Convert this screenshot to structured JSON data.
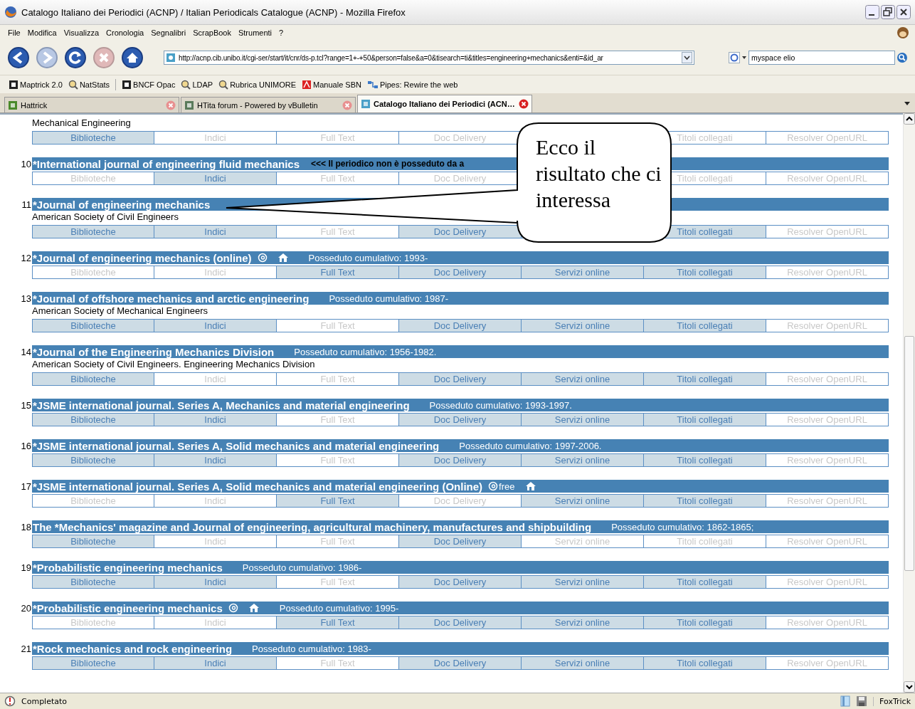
{
  "window": {
    "title": "Catalogo Italiano dei Periodici (ACNP) / Italian Periodicals Catalogue (ACNP) - Mozilla Firefox"
  },
  "menu": [
    "File",
    "Modifica",
    "Visualizza",
    "Cronologia",
    "Segnalibri",
    "ScrapBook",
    "Strumenti",
    "?"
  ],
  "navigation": {
    "buttons": [
      {
        "kind": "back",
        "disabled": false
      },
      {
        "kind": "forward",
        "disabled": true
      },
      {
        "kind": "reload",
        "disabled": false
      },
      {
        "kind": "stop",
        "disabled": true
      },
      {
        "kind": "home",
        "disabled": false
      }
    ],
    "url": "http://acnp.cib.unibo.it/cgi-ser/start/it/cnr/ds-p.tcl?range=1+-+50&person=false&a=0&tisearch=ti&titles=engineering+mechanics&enti=&id_ar",
    "search_value": "myspace elio"
  },
  "bookmarks": [
    {
      "label": "Maptrick 2.0",
      "kind": "page"
    },
    {
      "label": "NatStats",
      "kind": "search"
    },
    {
      "label": "BNCF Opac",
      "kind": "page"
    },
    {
      "label": "LDAP",
      "kind": "search"
    },
    {
      "label": "Rubrica UNIMORE",
      "kind": "search"
    },
    {
      "label": "Manuale SBN",
      "kind": "pdf"
    },
    {
      "label": "Pipes: Rewire the web",
      "kind": "pipes"
    }
  ],
  "tabs": [
    {
      "label": "Hattrick",
      "selected": false
    },
    {
      "label": "HTita forum - Powered by vBulletin",
      "selected": false
    },
    {
      "label": "Catalogo Italiano dei Periodici (ACN…",
      "selected": true
    }
  ],
  "results": [
    {
      "subtitle": "Mechanical Engineering",
      "cells": [
        {
          "label": "Biblioteche",
          "active": true
        },
        {
          "label": "Indici",
          "active": false
        },
        {
          "label": "Full Text",
          "active": false
        },
        {
          "label": "Doc Delivery",
          "active": false
        },
        null,
        {
          "label": "Titoli collegati",
          "active": false
        },
        {
          "label": "Resolver OpenURL",
          "active": false
        }
      ]
    },
    {
      "number": "10",
      "title": "*International journal of engineering fluid mechanics",
      "notice": "<<< Il periodico non è posseduto da a",
      "cells": [
        {
          "label": "Biblioteche",
          "active": false
        },
        {
          "label": "Indici",
          "active": true
        },
        {
          "label": "Full Text",
          "active": false
        },
        {
          "label": "Doc Delivery",
          "active": false
        },
        null,
        {
          "label": "Titoli collegati",
          "active": false
        },
        {
          "label": "Resolver OpenURL",
          "active": false
        }
      ]
    },
    {
      "number": "11",
      "title": "*Journal of engineering mechanics",
      "subtitle": "American Society of Civil Engineers",
      "cells": [
        {
          "label": "Biblioteche",
          "active": true
        },
        {
          "label": "Indici",
          "active": true
        },
        {
          "label": "Full Text",
          "active": false
        },
        {
          "label": "Doc Delivery",
          "active": true
        },
        null,
        {
          "label": "Titoli collegati",
          "active": true
        },
        {
          "label": "Resolver OpenURL",
          "active": false
        }
      ]
    },
    {
      "number": "12",
      "title": "*Journal of engineering mechanics (online)",
      "online": true,
      "home": true,
      "holdings": "Posseduto cumulativo: 1993-",
      "cells": [
        {
          "label": "Biblioteche",
          "active": false
        },
        {
          "label": "Indici",
          "active": false
        },
        {
          "label": "Full Text",
          "active": true
        },
        {
          "label": "Doc Delivery",
          "active": true
        },
        {
          "label": "Servizi online",
          "active": true
        },
        {
          "label": "Titoli collegati",
          "active": true
        },
        {
          "label": "Resolver OpenURL",
          "active": false
        }
      ]
    },
    {
      "number": "13",
      "title": "*Journal of offshore mechanics and arctic engineering",
      "holdings": "Posseduto cumulativo: 1987-",
      "subtitle": "American Society of Mechanical Engineers",
      "cells": [
        {
          "label": "Biblioteche",
          "active": true
        },
        {
          "label": "Indici",
          "active": true
        },
        {
          "label": "Full Text",
          "active": false
        },
        {
          "label": "Doc Delivery",
          "active": true
        },
        {
          "label": "Servizi online",
          "active": true
        },
        {
          "label": "Titoli collegati",
          "active": true
        },
        {
          "label": "Resolver OpenURL",
          "active": false
        }
      ]
    },
    {
      "number": "14",
      "title": "*Journal of the Engineering Mechanics Division",
      "holdings": "Posseduto cumulativo: 1956-1982.",
      "subtitle": "American Society of Civil Engineers. Engineering Mechanics Division",
      "cells": [
        {
          "label": "Biblioteche",
          "active": true
        },
        {
          "label": "Indici",
          "active": false
        },
        {
          "label": "Full Text",
          "active": false
        },
        {
          "label": "Doc Delivery",
          "active": true
        },
        {
          "label": "Servizi online",
          "active": true
        },
        {
          "label": "Titoli collegati",
          "active": true
        },
        {
          "label": "Resolver OpenURL",
          "active": false
        }
      ]
    },
    {
      "number": "15",
      "title": "*JSME international journal. Series A, Mechanics and material engineering",
      "holdings": "Posseduto cumulativo: 1993-1997.",
      "cells": [
        {
          "label": "Biblioteche",
          "active": true
        },
        {
          "label": "Indici",
          "active": true
        },
        {
          "label": "Full Text",
          "active": false
        },
        {
          "label": "Doc Delivery",
          "active": true
        },
        {
          "label": "Servizi online",
          "active": true
        },
        {
          "label": "Titoli collegati",
          "active": true
        },
        {
          "label": "Resolver OpenURL",
          "active": false
        }
      ]
    },
    {
      "number": "16",
      "title": "*JSME international journal. Series A, Solid mechanics and material engineering",
      "holdings": "Posseduto cumulativo: 1997-2006.",
      "cells": [
        {
          "label": "Biblioteche",
          "active": true
        },
        {
          "label": "Indici",
          "active": true
        },
        {
          "label": "Full Text",
          "active": false
        },
        {
          "label": "Doc Delivery",
          "active": true
        },
        {
          "label": "Servizi online",
          "active": true
        },
        {
          "label": "Titoli collegati",
          "active": true
        },
        {
          "label": "Resolver OpenURL",
          "active": false
        }
      ]
    },
    {
      "number": "17",
      "title": "*JSME international journal. Series A, Solid mechanics and material engineering (Online)",
      "online": true,
      "online_note": "free",
      "home": true,
      "cells": [
        {
          "label": "Biblioteche",
          "active": false
        },
        {
          "label": "Indici",
          "active": false
        },
        {
          "label": "Full Text",
          "active": true
        },
        {
          "label": "Doc Delivery",
          "active": false
        },
        {
          "label": "Servizi online",
          "active": true
        },
        {
          "label": "Titoli collegati",
          "active": true
        },
        {
          "label": "Resolver OpenURL",
          "active": false
        }
      ]
    },
    {
      "number": "18",
      "title": "The *Mechanics' magazine and Journal of engineering, agricultural machinery, manufactures and shipbuilding",
      "holdings": "Posseduto cumulativo: 1862-1865;",
      "cells": [
        {
          "label": "Biblioteche",
          "active": true
        },
        {
          "label": "Indici",
          "active": false
        },
        {
          "label": "Full Text",
          "active": false
        },
        {
          "label": "Doc Delivery",
          "active": true
        },
        {
          "label": "Servizi online",
          "active": false
        },
        {
          "label": "Titoli collegati",
          "active": false
        },
        {
          "label": "Resolver OpenURL",
          "active": false
        }
      ]
    },
    {
      "number": "19",
      "title": "*Probabilistic engineering mechanics",
      "holdings": "Posseduto cumulativo: 1986-",
      "cells": [
        {
          "label": "Biblioteche",
          "active": true
        },
        {
          "label": "Indici",
          "active": true
        },
        {
          "label": "Full Text",
          "active": false
        },
        {
          "label": "Doc Delivery",
          "active": true
        },
        {
          "label": "Servizi online",
          "active": true
        },
        {
          "label": "Titoli collegati",
          "active": true
        },
        {
          "label": "Resolver OpenURL",
          "active": false
        }
      ]
    },
    {
      "number": "20",
      "title": "*Probabilistic engineering mechanics",
      "online": true,
      "home": true,
      "holdings": "Posseduto cumulativo: 1995-",
      "cells": [
        {
          "label": "Biblioteche",
          "active": false
        },
        {
          "label": "Indici",
          "active": false
        },
        {
          "label": "Full Text",
          "active": true
        },
        {
          "label": "Doc Delivery",
          "active": true
        },
        {
          "label": "Servizi online",
          "active": true
        },
        {
          "label": "Titoli collegati",
          "active": true
        },
        {
          "label": "Resolver OpenURL",
          "active": false
        }
      ]
    },
    {
      "number": "21",
      "title": "*Rock mechanics and rock engineering",
      "holdings": "Posseduto cumulativo: 1983-",
      "cells": [
        {
          "label": "Biblioteche",
          "active": true
        },
        {
          "label": "Indici",
          "active": true
        },
        {
          "label": "Full Text",
          "active": false
        },
        {
          "label": "Doc Delivery",
          "active": true
        },
        {
          "label": "Servizi online",
          "active": true
        },
        {
          "label": "Titoli collegati",
          "active": true
        },
        {
          "label": "Resolver OpenURL",
          "active": false
        }
      ]
    }
  ],
  "callout": {
    "text": "Ecco il risultato che ci interessa"
  },
  "status_bar": {
    "text": "Completato",
    "addon": "FoxTrick"
  }
}
